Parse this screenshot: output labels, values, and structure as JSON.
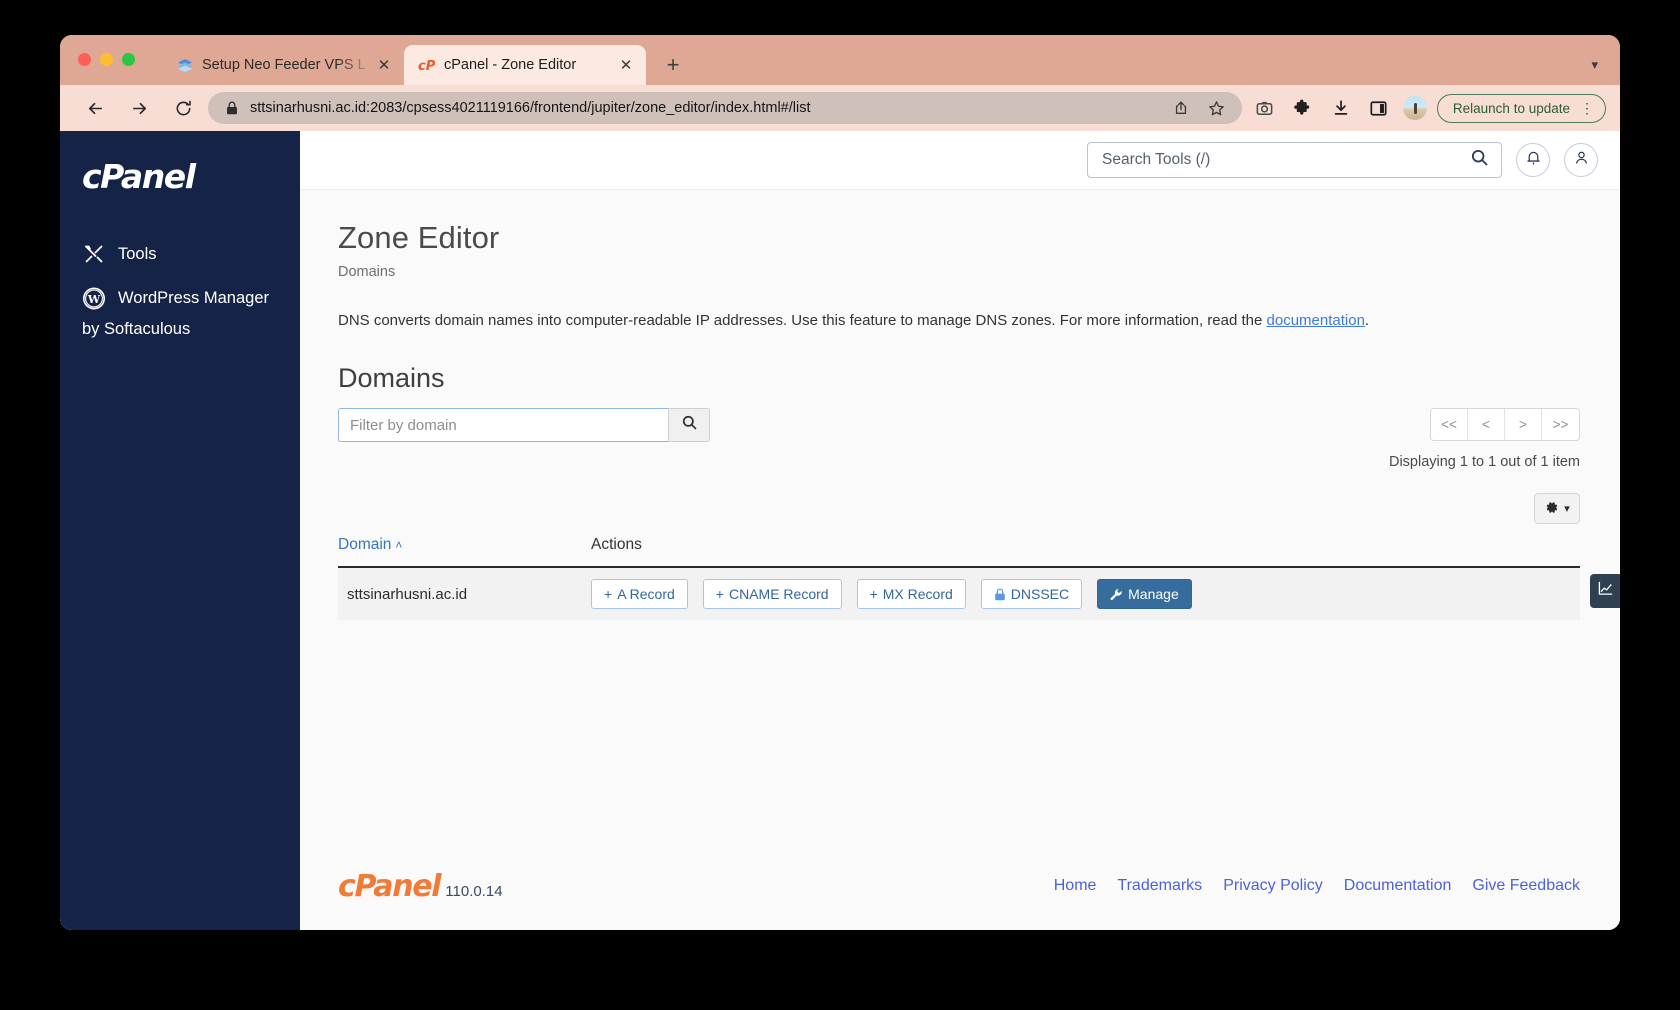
{
  "browser": {
    "tabs": [
      {
        "title": "Setup Neo Feeder VPS L... | M",
        "favicon": "stack-icon",
        "active": false
      },
      {
        "title": "cPanel - Zone Editor",
        "favicon": "cpanel-icon",
        "active": true
      }
    ],
    "new_tab_label": "+",
    "tab_list_caret": "▾",
    "url": "sttsinarhusni.ac.id:2083/cpsess4021119166/frontend/jupiter/zone_editor/index.html#/list",
    "relaunch_label": "Relaunch to update",
    "relaunch_kebab": "⋮",
    "toolbar_icons": [
      "share-icon",
      "bookmark-star-icon",
      "screenshot-icon",
      "extensions-puzzle-icon",
      "downloads-icon",
      "side-panel-icon"
    ],
    "tab_bar_color": "#dfa894",
    "toolbar_color": "#f7ddd3"
  },
  "sidebar": {
    "logo": "cPanel",
    "items": [
      {
        "label": "Tools",
        "icon": "tools-icon"
      },
      {
        "label": "WordPress Manager",
        "sublabel": "by Softaculous",
        "icon": "wordpress-icon"
      }
    ],
    "background": "#152346"
  },
  "header": {
    "search": {
      "placeholder": "Search Tools (/)",
      "value": "",
      "icon": "search-icon"
    },
    "notifications_icon": "bell-icon",
    "account_icon": "user-icon"
  },
  "main": {
    "page_title": "Zone Editor",
    "breadcrumb": "Domains",
    "intro": {
      "text_before": "DNS converts domain names into computer-readable IP addresses. Use this feature to manage DNS zones. For more information, read the ",
      "link_label": "documentation",
      "text_after": "."
    },
    "domains_heading": "Domains",
    "filter": {
      "placeholder": "Filter by domain",
      "value": "",
      "search_icon": "search-icon"
    },
    "pager": {
      "first_label": "<<",
      "prev_label": "<",
      "next_label": ">",
      "last_label": ">>"
    },
    "displaying_text": "Displaying 1 to 1 out of 1 item",
    "gear_button": {
      "icon": "gear-icon",
      "caret": "▾"
    },
    "table": {
      "columns": [
        {
          "key": "domain",
          "label": "Domain",
          "sorted": "asc",
          "sort_caret": "˄"
        },
        {
          "key": "actions",
          "label": "Actions"
        }
      ],
      "rows": [
        {
          "domain": "sttsinarhusni.ac.id",
          "actions": [
            {
              "label": "A Record",
              "glyph": "+",
              "icon": "plus-icon",
              "style": "outline"
            },
            {
              "label": "CNAME Record",
              "glyph": "+",
              "icon": "plus-icon",
              "style": "outline"
            },
            {
              "label": "MX Record",
              "glyph": "+",
              "icon": "plus-icon",
              "style": "outline"
            },
            {
              "label": "DNSSEC",
              "glyph": "🔒",
              "icon": "lock-icon",
              "style": "outline"
            },
            {
              "label": "Manage",
              "glyph": "🔧",
              "icon": "wrench-icon",
              "style": "primary"
            }
          ]
        }
      ]
    },
    "stats_flyout_icon": "chart-icon"
  },
  "footer": {
    "logo": "cPanel",
    "version": "110.0.14",
    "links": [
      "Home",
      "Trademarks",
      "Privacy Policy",
      "Documentation",
      "Give Feedback"
    ],
    "link_color": "#4d62d8"
  }
}
